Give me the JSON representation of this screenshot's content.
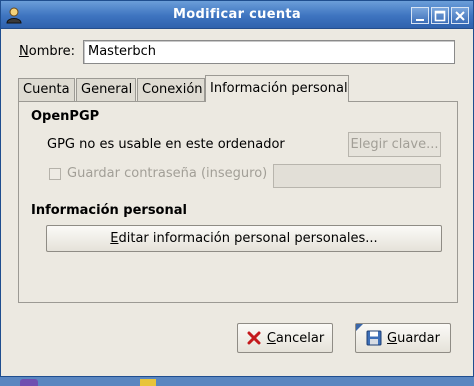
{
  "window": {
    "title": "Modificar cuenta"
  },
  "name_field": {
    "label_mnemonic": "N",
    "label_rest": "ombre:",
    "value": "Masterbch"
  },
  "tabs": [
    {
      "label": "Cuenta",
      "active": false
    },
    {
      "label": "General",
      "active": false
    },
    {
      "label": "Conexión",
      "active": false
    },
    {
      "label": "Información personal",
      "active": true
    }
  ],
  "openpgp": {
    "title": "OpenPGP",
    "status_text": "GPG no es usable en este ordenador",
    "choose_key_button": "Elegir clave...",
    "save_password_label": "Guardar contraseña (inseguro)",
    "save_password_checked": false
  },
  "personal_info": {
    "title": "Información personal",
    "edit_button_mnemonic": "E",
    "edit_button_rest": "ditar información personal personales..."
  },
  "buttons": {
    "cancel_mnemonic": "C",
    "cancel_rest": "ancelar",
    "save_mnemonic": "G",
    "save_rest": "uardar"
  },
  "colors": {
    "titlebar": "#3e74c0",
    "window_bg": "#ece9e1",
    "disabled_text": "#a29f97"
  },
  "icons": [
    "app-icon",
    "minimize-icon",
    "maximize-icon",
    "close-icon",
    "cancel-x-icon",
    "save-floppy-icon"
  ]
}
